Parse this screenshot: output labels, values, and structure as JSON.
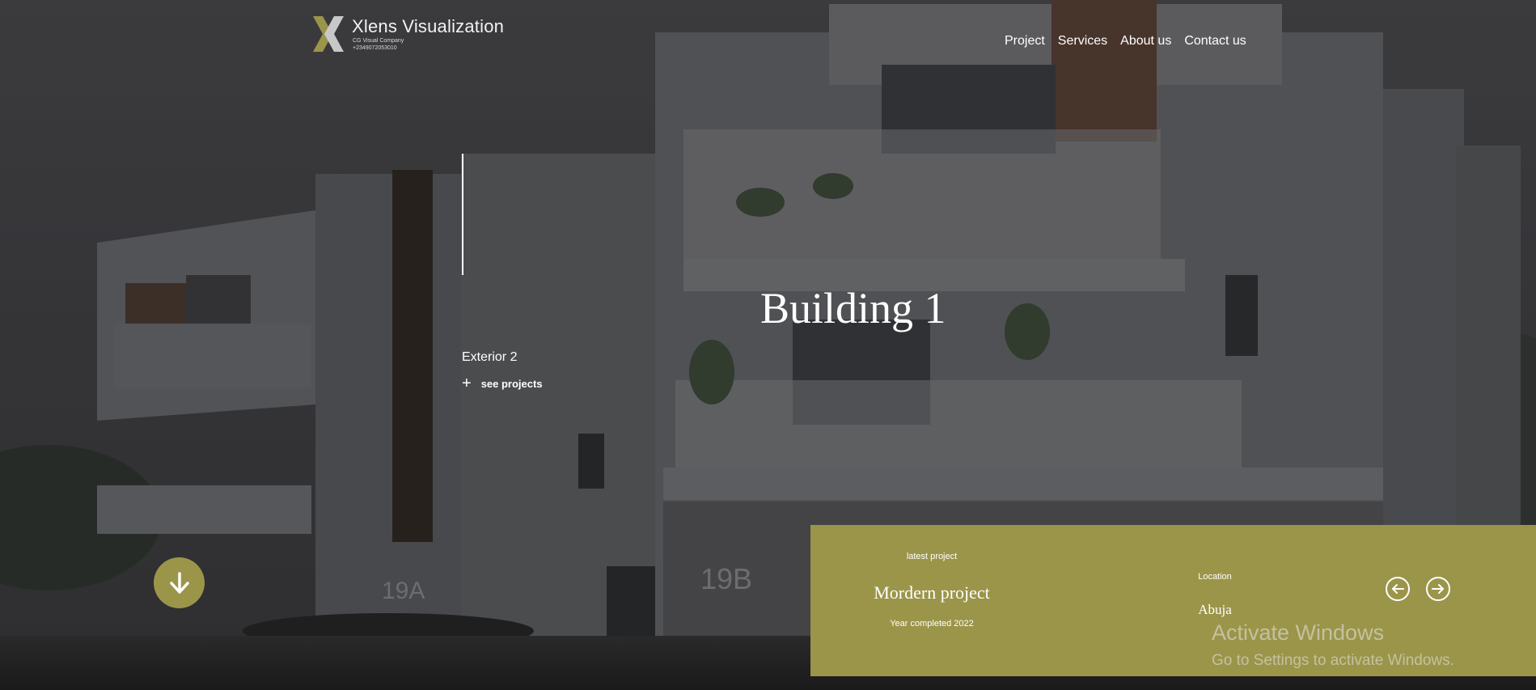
{
  "brand": {
    "name": "Xlens Visualization",
    "tagline": "CG Visual Company",
    "phone": "+2349072053010"
  },
  "nav": {
    "items": [
      "Project",
      "Services",
      "About us",
      "Contact us"
    ]
  },
  "hero": {
    "title": "Building 1",
    "subtitle": "Exterior 2",
    "cta_label": "see projects",
    "cta_icon": "plus-icon",
    "plate_left": "19A",
    "plate_right": "19B"
  },
  "scroll_button": {
    "icon": "arrow-down-icon"
  },
  "project_panel": {
    "latest_label": "latest project",
    "name": "Mordern project",
    "year": "Year completed 2022",
    "location_label": "Location",
    "location": "Abuja",
    "prev_icon": "arrow-left-circle-icon",
    "next_icon": "arrow-right-circle-icon"
  },
  "watermark": {
    "title": "Activate Windows",
    "subtitle": "Go to Settings to activate Windows."
  },
  "colors": {
    "accent": "#9b954a",
    "overlay": "#3f3f42",
    "text": "#ffffff"
  }
}
